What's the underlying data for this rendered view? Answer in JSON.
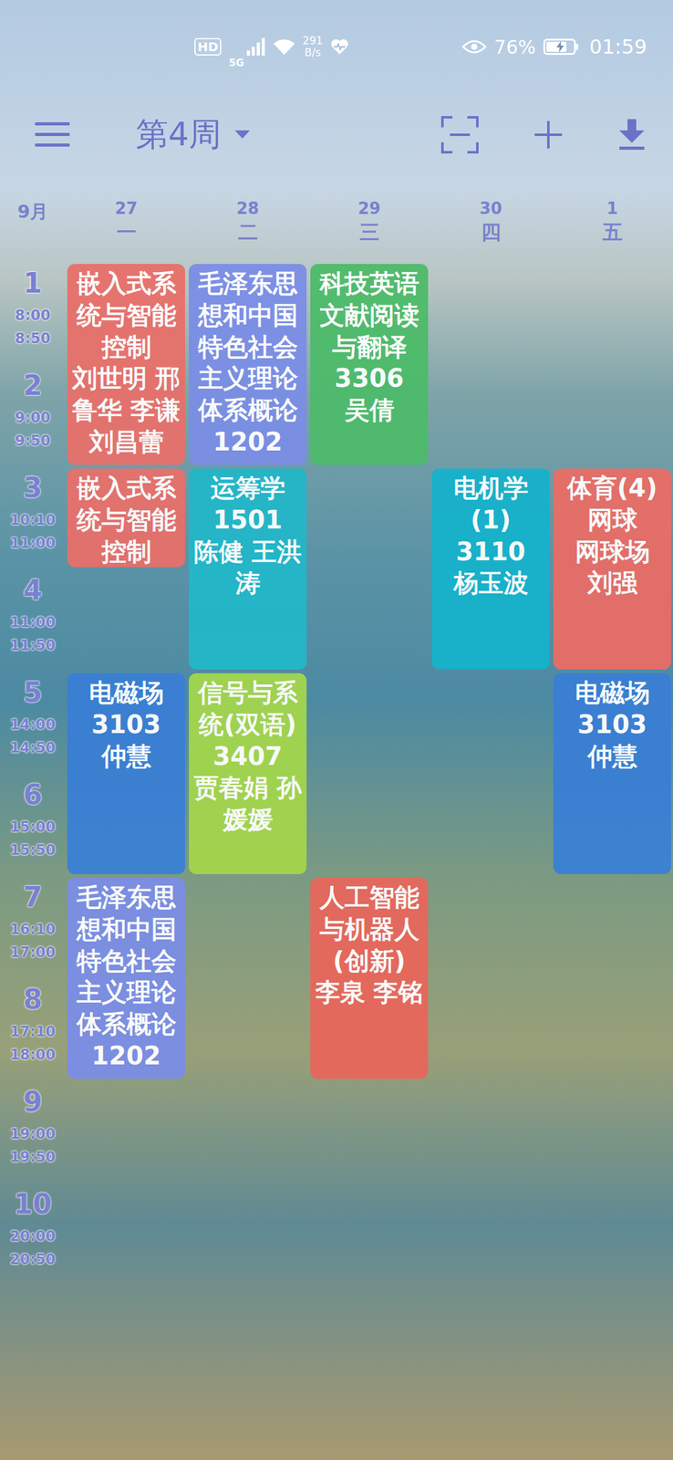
{
  "status_bar": {
    "hd": "HD",
    "network": "5G",
    "speed": "291",
    "speed_unit": "B/s",
    "battery": "76%",
    "battery_level": 0.76,
    "time": "01:59"
  },
  "toolbar": {
    "week": "第4周"
  },
  "header": {
    "month": "9月",
    "days": [
      {
        "date": "27",
        "weekday": "一"
      },
      {
        "date": "28",
        "weekday": "二"
      },
      {
        "date": "29",
        "weekday": "三"
      },
      {
        "date": "30",
        "weekday": "四"
      },
      {
        "date": "1",
        "weekday": "五"
      }
    ]
  },
  "periods": [
    {
      "number": "1",
      "start": "8:00",
      "end": "8:50"
    },
    {
      "number": "2",
      "start": "9:00",
      "end": "9:50"
    },
    {
      "number": "3",
      "start": "10:10",
      "end": "11:00"
    },
    {
      "number": "4",
      "start": "11:00",
      "end": "11:50"
    },
    {
      "number": "5",
      "start": "14:00",
      "end": "14:50"
    },
    {
      "number": "6",
      "start": "15:00",
      "end": "15:50"
    },
    {
      "number": "7",
      "start": "16:10",
      "end": "17:00"
    },
    {
      "number": "8",
      "start": "17:10",
      "end": "18:00"
    },
    {
      "number": "9",
      "start": "19:00",
      "end": "19:50"
    },
    {
      "number": "10",
      "start": "20:00",
      "end": "20:50"
    }
  ],
  "courses": [
    {
      "name": "嵌入式系统与智能控制",
      "teacher": "刘世明 邢鲁华 李谦 刘昌蕾",
      "day": 1,
      "start": 1,
      "span": 2,
      "color": "#e8706a"
    },
    {
      "name": "毛泽东思想和中国特色社会主义理论体系概论",
      "room": "1202",
      "day": 2,
      "start": 1,
      "span": 2,
      "color": "#7b8ee6"
    },
    {
      "name": "科技英语文献阅读与翻译",
      "room": "3306",
      "teacher": "吴倩",
      "day": 3,
      "start": 1,
      "span": 2,
      "color": "#4dbb6a"
    },
    {
      "name": "嵌入式系统与智能控制",
      "day": 1,
      "start": 3,
      "span": 1,
      "color": "#e8706a"
    },
    {
      "name": "运筹学",
      "room": "1501",
      "teacher": "陈健 王洪涛",
      "day": 2,
      "start": 3,
      "span": 2,
      "color": "#22b7c9"
    },
    {
      "name": "电机学(1)",
      "room": "3110",
      "teacher": "杨玉波",
      "day": 4,
      "start": 3,
      "span": 2,
      "color": "#16b2cc"
    },
    {
      "name": "体育(4)网球",
      "room": "网球场",
      "teacher": "刘强",
      "day": 5,
      "start": 3,
      "span": 2,
      "color": "#ea6d66"
    },
    {
      "name": "电磁场",
      "room": "3103",
      "teacher": "仲慧",
      "day": 1,
      "start": 5,
      "span": 2,
      "color": "#3a7fd5"
    },
    {
      "name": "信号与系统(双语)",
      "room": "3407",
      "teacher": "贾春娟 孙媛媛",
      "day": 2,
      "start": 5,
      "span": 2,
      "color": "#a3d64c"
    },
    {
      "name": "电磁场",
      "room": "3103",
      "teacher": "仲慧",
      "day": 5,
      "start": 5,
      "span": 2,
      "color": "#3a7fd5"
    },
    {
      "name": "毛泽东思想和中国特色社会主义理论体系概论",
      "room": "1202",
      "day": 1,
      "start": 7,
      "span": 2,
      "color": "#7b8ee6"
    },
    {
      "name": "人工智能与机器人(创新)",
      "teacher": "李泉 李铭",
      "day": 3,
      "start": 7,
      "span": 2,
      "color": "#e8675c"
    }
  ]
}
